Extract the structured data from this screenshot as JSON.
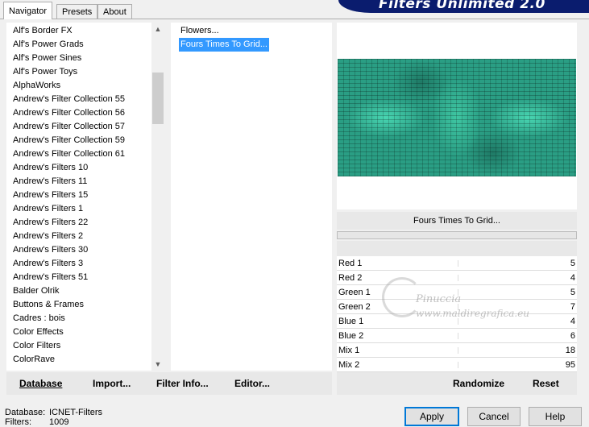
{
  "tabs": [
    "Navigator",
    "Presets",
    "About"
  ],
  "banner_title": "Filters Unlimited 2.0",
  "categories": [
    "Alf's Border FX",
    "Alf's Power Grads",
    "Alf's Power Sines",
    "Alf's Power Toys",
    "AlphaWorks",
    "Andrew's Filter Collection 55",
    "Andrew's Filter Collection 56",
    "Andrew's Filter Collection 57",
    "Andrew's Filter Collection 59",
    "Andrew's Filter Collection 61",
    "Andrew's Filters 10",
    "Andrew's Filters 11",
    "Andrew's Filters 15",
    "Andrew's Filters 1",
    "Andrew's Filters 22",
    "Andrew's Filters 2",
    "Andrew's Filters 30",
    "Andrew's Filters 3",
    "Andrew's Filters 51",
    "Balder Olrik",
    "Buttons & Frames",
    "Cadres : bois",
    "Color Effects",
    "Color Filters",
    "ColorRave"
  ],
  "filters": [
    "Flowers...",
    "Fours Times To Grid..."
  ],
  "selected_filter_index": 1,
  "selected_filter_name": "Fours Times To Grid...",
  "controls": [
    {
      "label": "Red 1",
      "value": "5"
    },
    {
      "label": "Red 2",
      "value": "4"
    },
    {
      "label": "Green 1",
      "value": "5"
    },
    {
      "label": "Green 2",
      "value": "7"
    },
    {
      "label": "Blue 1",
      "value": "4"
    },
    {
      "label": "Blue 2",
      "value": "6"
    },
    {
      "label": "Mix 1",
      "value": "18"
    },
    {
      "label": "Mix 2",
      "value": "95"
    }
  ],
  "watermark": {
    "line1": "Pinuccia",
    "line2": "www.maldiregrafica.eu"
  },
  "left_toolbar": {
    "database": "Database",
    "import": "Import...",
    "filter_info": "Filter Info...",
    "editor": "Editor..."
  },
  "right_toolbar": {
    "randomize": "Randomize",
    "reset": "Reset"
  },
  "status": {
    "database_label": "Database:",
    "database_value": "ICNET-Filters",
    "filters_label": "Filters:",
    "filters_value": "1009"
  },
  "buttons": {
    "apply": "Apply",
    "cancel": "Cancel",
    "help": "Help"
  },
  "colors": {
    "selection": "#3399ff",
    "banner": "#0a1c6e",
    "preview": "#2a9e84"
  }
}
